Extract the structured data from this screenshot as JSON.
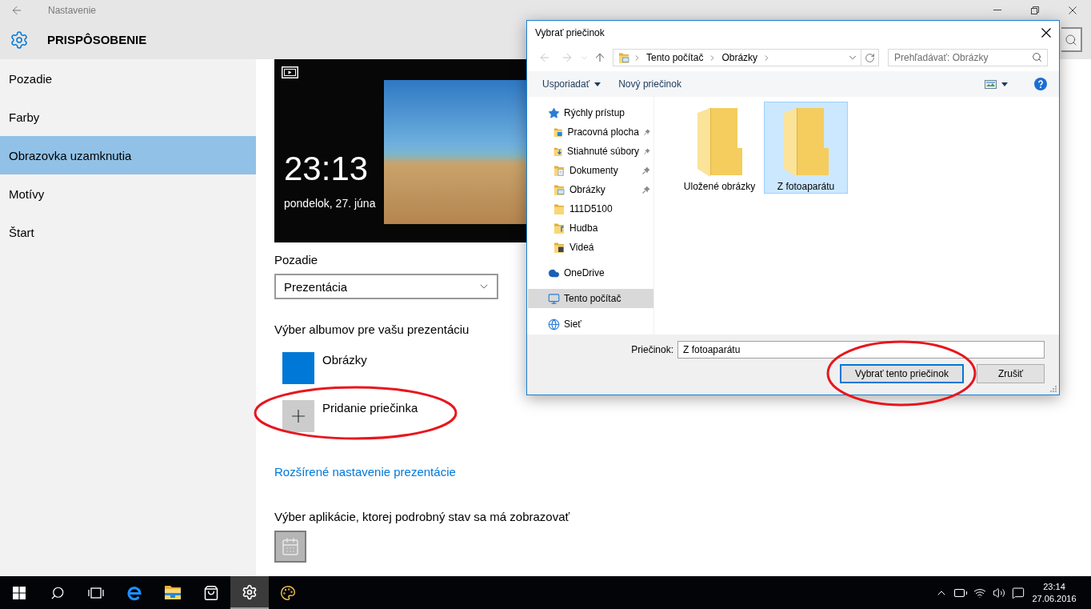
{
  "settings_window": {
    "title": "Nastavenie",
    "header": "PRISPÔSOBENIE"
  },
  "sidebar": {
    "items": [
      {
        "label": "Pozadie",
        "selected": false
      },
      {
        "label": "Farby",
        "selected": false
      },
      {
        "label": "Obrazovka uzamknutia",
        "selected": true
      },
      {
        "label": "Motívy",
        "selected": false
      },
      {
        "label": "Štart",
        "selected": false
      }
    ]
  },
  "lock_screen_preview": {
    "time": "23:13",
    "date": "pondelok, 27. júna"
  },
  "background": {
    "label": "Pozadie",
    "value": "Prezentácia"
  },
  "albums": {
    "heading": "Výber albumov pre vašu prezentáciu",
    "items": [
      {
        "kind": "album",
        "label": "Obrázky",
        "circled": false
      },
      {
        "kind": "add",
        "label": "Pridanie priečinka",
        "circled": true
      }
    ]
  },
  "slideshow_link": "Rozšírené nastavenie prezentácie",
  "detailed_status": {
    "heading": "Výber aplikácie, ktorej podrobný stav sa má zobrazovať"
  },
  "dialog": {
    "title": "Vybrať priečinok",
    "nav_buttons": [
      {
        "kind": "back",
        "disabled": true
      },
      {
        "kind": "forward",
        "disabled": true
      },
      {
        "kind": "recent",
        "disabled": true
      },
      {
        "kind": "up",
        "disabled": false
      }
    ],
    "breadcrumb": [
      "Tento počítač",
      "Obrázky"
    ],
    "search": {
      "placeholder": "Prehľadávať: Obrázky"
    },
    "toolbar": {
      "organize": "Usporiadať",
      "new_folder": "Nový priečinok"
    },
    "nav_pane": [
      {
        "label": "Rýchly prístup",
        "kind": "quick_access",
        "selected": false,
        "children": [
          {
            "label": "Pracovná plocha",
            "kind": "desktop",
            "pinned": true,
            "selected": false
          },
          {
            "label": "Stiahnuté súbory",
            "kind": "downloads",
            "pinned": true,
            "selected": false
          },
          {
            "label": "Dokumenty",
            "kind": "documents",
            "pinned": true,
            "selected": false
          },
          {
            "label": "Obrázky",
            "kind": "pictures",
            "pinned": true,
            "selected": false
          },
          {
            "label": "111D5100",
            "kind": "folder",
            "pinned": false,
            "selected": false
          },
          {
            "label": "Hudba",
            "kind": "music",
            "pinned": false,
            "selected": false
          },
          {
            "label": "Videá",
            "kind": "videos",
            "pinned": false,
            "selected": false
          }
        ]
      },
      {
        "label": "OneDrive",
        "kind": "cloud",
        "selected": false
      },
      {
        "label": "Tento počítač",
        "kind": "computer",
        "selected": true
      },
      {
        "label": "Sieť",
        "kind": "network",
        "selected": false
      }
    ],
    "items": [
      {
        "label": "Uložené obrázky",
        "selected": false
      },
      {
        "label": "Z fotoaparátu",
        "selected": true
      }
    ],
    "folder_field": {
      "label": "Priečinok:",
      "value": "Z fotoaparátu"
    },
    "buttons": [
      {
        "label": "Vybrať tento priečinok",
        "default": true,
        "circled": true
      },
      {
        "label": "Zrušiť",
        "default": false,
        "circled": false
      }
    ]
  },
  "taskbar": {
    "apps": [
      {
        "kind": "start",
        "active": false
      },
      {
        "kind": "search",
        "active": false
      },
      {
        "kind": "task_view",
        "active": false
      },
      {
        "kind": "edge",
        "active": false
      },
      {
        "kind": "explorer",
        "active": false
      },
      {
        "kind": "store",
        "active": false
      },
      {
        "kind": "settings",
        "active": true
      },
      {
        "kind": "paint",
        "active": false
      }
    ],
    "clock": {
      "time": "23:14",
      "date": "27.06.2016"
    }
  }
}
